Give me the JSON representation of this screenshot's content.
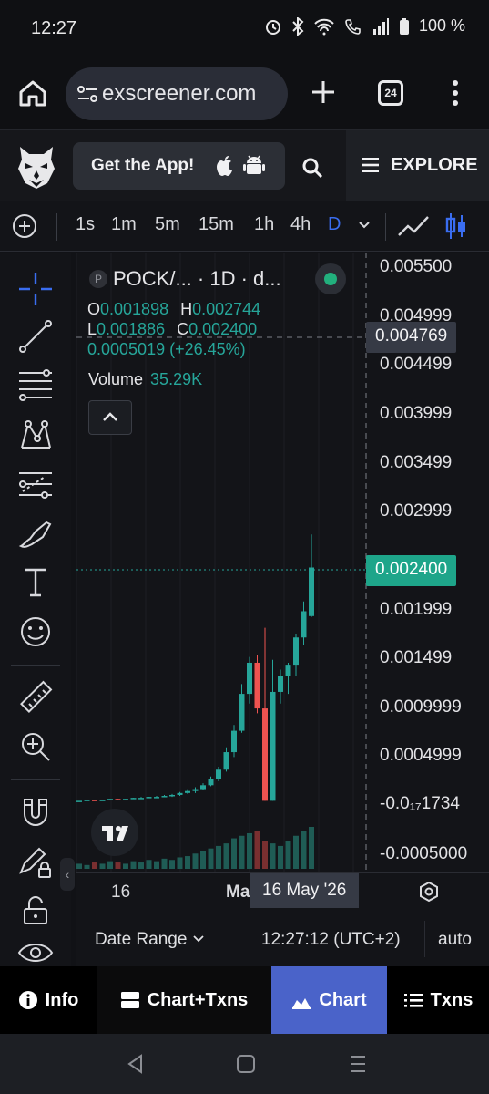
{
  "status": {
    "time": "12:27",
    "battery": "100 %",
    "icons": [
      "alarm-icon",
      "bluetooth-icon",
      "wifi-icon",
      "wifi-calling-icon",
      "signal-icon",
      "battery-icon"
    ]
  },
  "browser": {
    "url": "exscreener.com",
    "tab_count": "24",
    "icons": [
      "home-icon",
      "site-settings-icon",
      "plus-icon",
      "kebab-menu-icon"
    ]
  },
  "header": {
    "get_app_label": "Get the App!",
    "explore_label": "EXPLORE",
    "icons": [
      "owl-logo-icon",
      "apple-icon",
      "android-icon",
      "search-icon",
      "menu-icon"
    ]
  },
  "toolbar": {
    "intervals": [
      "1s",
      "1m",
      "5m",
      "15m",
      "1h",
      "4h",
      "D"
    ],
    "active_interval": "D"
  },
  "legend": {
    "badge": "P",
    "symbol": "POCK/... · 1D · d...",
    "o_label": "O",
    "o_value": "0.001898",
    "h_label": "H",
    "h_value": "0.002744",
    "l_label": "L",
    "l_value": "0.001886",
    "c_label": "C",
    "c_value": "0.002400",
    "change": "0.0005019 (+26.45%)",
    "volume_label": "Volume",
    "volume_value": "35.29K"
  },
  "price_axis": {
    "labels": [
      "0.005500",
      "0.004999",
      "0.004499",
      "0.003999",
      "0.003499",
      "0.002999",
      "0.001999",
      "0.001499",
      "0.0009999",
      "0.0004999",
      "-0.0₁₇1734",
      "-0.0005000"
    ],
    "crosshair_price": "0.004769",
    "last_price": "0.002400"
  },
  "time_axis": {
    "left_label": "16",
    "mid_label": "Ma",
    "crosshair_date": "16 May '26"
  },
  "footer": {
    "date_range": "Date Range",
    "clock": "12:27:12 (UTC+2)",
    "auto": "auto"
  },
  "tabs": [
    {
      "label": "Info",
      "icon": "info-icon"
    },
    {
      "label": "Chart+Txns",
      "icon": "split-view-icon"
    },
    {
      "label": "Chart",
      "icon": "chart-icon"
    },
    {
      "label": "Txns",
      "icon": "list-icon"
    }
  ],
  "active_tab": "Chart",
  "colors": {
    "up": "#26a69a",
    "down": "#ef5350",
    "accent": "#4a63c9",
    "interval_active": "#3a6df0",
    "last_price_tag": "#1ea58a"
  },
  "chart_data": {
    "type": "candlestick",
    "interval": "1D",
    "ylim": [
      -0.00055,
      0.0055
    ],
    "candles": [
      {
        "o": 0.0,
        "h": 0.0,
        "l": 0.0,
        "c": 0.0
      },
      {
        "o": 0.0,
        "h": 0.0,
        "l": 0.0,
        "c": 1e-05
      },
      {
        "o": 1e-05,
        "h": 1e-05,
        "l": 0.0,
        "c": 0.0
      },
      {
        "o": 0.0,
        "h": 1e-05,
        "l": 0.0,
        "c": 1e-05
      },
      {
        "o": 1e-05,
        "h": 2e-05,
        "l": 1e-05,
        "c": 2e-05
      },
      {
        "o": 2e-05,
        "h": 2e-05,
        "l": 1e-05,
        "c": 1e-05
      },
      {
        "o": 1e-05,
        "h": 2e-05,
        "l": 1e-05,
        "c": 2e-05
      },
      {
        "o": 2e-05,
        "h": 3e-05,
        "l": 2e-05,
        "c": 3e-05
      },
      {
        "o": 3e-05,
        "h": 4e-05,
        "l": 2e-05,
        "c": 3e-05
      },
      {
        "o": 3e-05,
        "h": 4e-05,
        "l": 3e-05,
        "c": 4e-05
      },
      {
        "o": 4e-05,
        "h": 5e-05,
        "l": 3e-05,
        "c": 4e-05
      },
      {
        "o": 4e-05,
        "h": 6e-05,
        "l": 4e-05,
        "c": 5e-05
      },
      {
        "o": 5e-05,
        "h": 7e-05,
        "l": 4e-05,
        "c": 6e-05
      },
      {
        "o": 6e-05,
        "h": 9e-05,
        "l": 5e-05,
        "c": 8e-05
      },
      {
        "o": 8e-05,
        "h": 0.00012,
        "l": 7e-05,
        "c": 0.0001
      },
      {
        "o": 0.0001,
        "h": 0.00014,
        "l": 8e-05,
        "c": 0.00012
      },
      {
        "o": 0.00012,
        "h": 0.00018,
        "l": 0.00011,
        "c": 0.00016
      },
      {
        "o": 0.00016,
        "h": 0.00025,
        "l": 0.00015,
        "c": 0.00022
      },
      {
        "o": 0.00022,
        "h": 0.00035,
        "l": 0.0002,
        "c": 0.00032
      },
      {
        "o": 0.00032,
        "h": 0.00055,
        "l": 0.0003,
        "c": 0.0005
      },
      {
        "o": 0.0005,
        "h": 0.00078,
        "l": 0.00045,
        "c": 0.00072
      },
      {
        "o": 0.00072,
        "h": 0.0012,
        "l": 0.0007,
        "c": 0.0011
      },
      {
        "o": 0.0011,
        "h": 0.00148,
        "l": 0.001,
        "c": 0.00142
      },
      {
        "o": 0.00142,
        "h": 0.0015,
        "l": 0.0009,
        "c": 0.00095
      },
      {
        "o": 0.00095,
        "h": 0.00178,
        "l": 0.0,
        "c": 0.0
      },
      {
        "o": 0.0,
        "h": 0.00145,
        "l": 0.0,
        "c": 0.00112
      },
      {
        "o": 0.00112,
        "h": 0.00135,
        "l": 0.001,
        "c": 0.00128
      },
      {
        "o": 0.00128,
        "h": 0.00142,
        "l": 0.0011,
        "c": 0.0014
      },
      {
        "o": 0.0014,
        "h": 0.00172,
        "l": 0.00128,
        "c": 0.00168
      },
      {
        "o": 0.00168,
        "h": 0.00205,
        "l": 0.0016,
        "c": 0.00195
      },
      {
        "o": 0.0019,
        "h": 0.00274,
        "l": 0.00189,
        "c": 0.0024
      }
    ],
    "volumes": [
      4,
      3,
      5,
      4,
      6,
      5,
      4,
      6,
      5,
      7,
      6,
      8,
      7,
      9,
      10,
      12,
      14,
      16,
      18,
      20,
      24,
      26,
      28,
      30,
      22,
      20,
      18,
      22,
      26,
      30,
      33
    ]
  }
}
